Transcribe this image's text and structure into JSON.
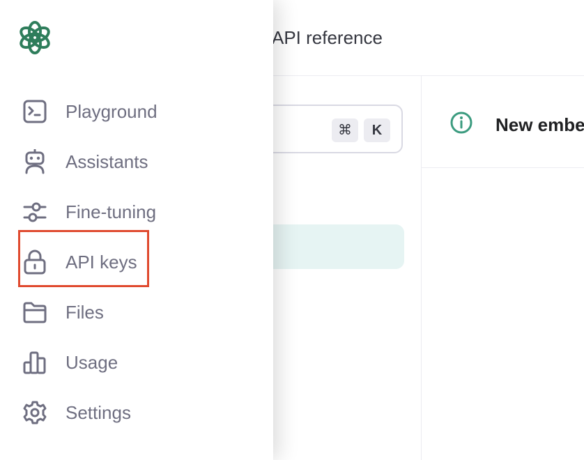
{
  "topbar": {
    "link_label": "API reference"
  },
  "search": {
    "shortcut_modifier": "⌘",
    "shortcut_key": "K"
  },
  "banner": {
    "title": "New embe"
  },
  "sidebar": {
    "items": [
      {
        "label": "Playground",
        "icon": "terminal-icon"
      },
      {
        "label": "Assistants",
        "icon": "robot-icon"
      },
      {
        "label": "Fine-tuning",
        "icon": "sliders-icon"
      },
      {
        "label": "API keys",
        "icon": "lock-icon",
        "highlighted": true
      },
      {
        "label": "Files",
        "icon": "folder-icon"
      },
      {
        "label": "Usage",
        "icon": "bar-chart-icon"
      },
      {
        "label": "Settings",
        "icon": "gear-icon"
      }
    ]
  },
  "colors": {
    "brand_green": "#10a37f",
    "logo_green": "#2e7d5b",
    "highlight_red": "#e04a2f",
    "nav_text": "#6e6e80",
    "info_teal": "#3b9b7f"
  }
}
